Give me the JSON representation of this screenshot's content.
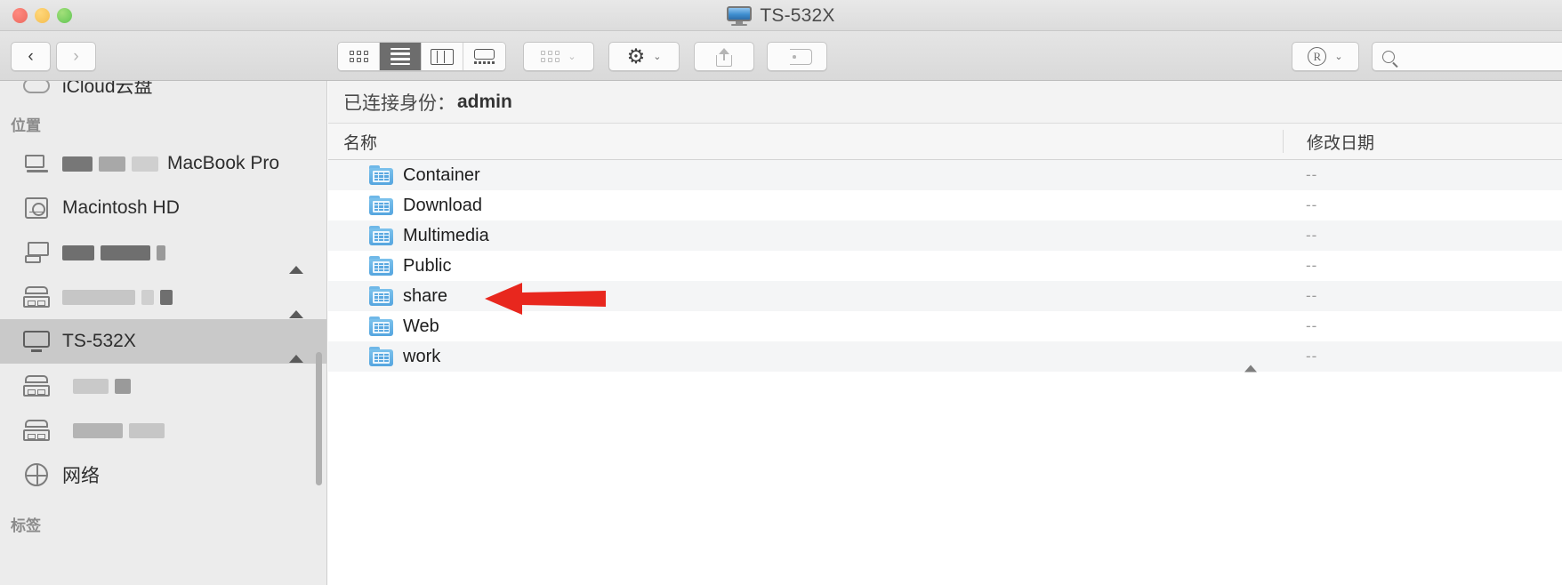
{
  "window": {
    "title": "TS-532X",
    "title_icon": "display-monitor-icon",
    "traffic_lights": [
      "close-button",
      "minimize-button",
      "zoom-button"
    ]
  },
  "toolbar": {
    "back_label": "‹",
    "forward_label": "›",
    "view_modes": [
      {
        "name": "icon-view",
        "label": "icon-grid-icon",
        "active": false
      },
      {
        "name": "list-view",
        "label": "list-lines-icon",
        "active": true
      },
      {
        "name": "column-view",
        "label": "columns-icon",
        "active": false
      },
      {
        "name": "gallery-view",
        "label": "gallery-icon",
        "active": false
      }
    ],
    "arrange_label": "arrange-grid-icon",
    "arrange_chevron": "⌄",
    "action_label": "⚙",
    "action_chevron": "⌄",
    "share_label": "share-upload-icon",
    "tag_label": "tag-icon",
    "rtm_label": "®",
    "rtm_chevron": "⌄",
    "search_icon": "search-magnifier-icon"
  },
  "sidebar": {
    "items": [
      {
        "name": "sidebar-item-icloud",
        "label": "iCloud云盘",
        "icon": "cloud-icon",
        "type": "item",
        "eject": false,
        "selected": false,
        "redacted": null
      },
      {
        "name": "sidebar-heading-locations",
        "label": "位置",
        "type": "heading"
      },
      {
        "name": "sidebar-item-macbook-pro",
        "label": "MacBook Pro",
        "icon": "laptop-screen-icon",
        "type": "item",
        "eject": false,
        "selected": false,
        "redacted": [
          34,
          30,
          30
        ]
      },
      {
        "name": "sidebar-item-macintosh-hd",
        "label": "Macintosh HD",
        "icon": "hard-disk-icon",
        "type": "item",
        "eject": false,
        "selected": false,
        "redacted": null
      },
      {
        "name": "sidebar-item-redacted-1",
        "label": "",
        "icon": "server-screen-icon",
        "type": "item",
        "eject": true,
        "selected": false,
        "redacted": [
          36,
          56,
          10
        ]
      },
      {
        "name": "sidebar-item-redacted-2",
        "label": "",
        "icon": "nas-icon",
        "type": "item",
        "eject": true,
        "selected": false,
        "redacted": [
          82,
          14,
          14
        ]
      },
      {
        "name": "sidebar-item-ts-532x",
        "label": "TS-532X",
        "icon": "display-monitor-icon",
        "type": "item",
        "eject": true,
        "selected": true,
        "redacted": null
      },
      {
        "name": "sidebar-item-redacted-3",
        "label": "",
        "icon": "nas-icon",
        "type": "item",
        "eject": false,
        "selected": false,
        "redacted": [
          40,
          18
        ]
      },
      {
        "name": "sidebar-item-redacted-4",
        "label": "",
        "icon": "nas-icon",
        "type": "item",
        "eject": false,
        "selected": false,
        "redacted": [
          56,
          40
        ]
      },
      {
        "name": "sidebar-item-network",
        "label": "网络",
        "icon": "globe-icon",
        "type": "item",
        "eject": false,
        "selected": false,
        "redacted": null
      },
      {
        "name": "sidebar-heading-tags",
        "label": "标签",
        "type": "heading"
      }
    ]
  },
  "main": {
    "connection_prefix": "已连接身份：",
    "connection_user": "admin",
    "columns": {
      "name": "名称",
      "date_modified": "修改日期"
    },
    "rows": [
      {
        "name": "Container",
        "date": "--",
        "icon": "shared-folder-icon",
        "eject": false
      },
      {
        "name": "Download",
        "date": "--",
        "icon": "shared-folder-icon",
        "eject": false
      },
      {
        "name": "Multimedia",
        "date": "--",
        "icon": "shared-folder-icon",
        "eject": false
      },
      {
        "name": "Public",
        "date": "--",
        "icon": "shared-folder-icon",
        "eject": false
      },
      {
        "name": "share",
        "date": "--",
        "icon": "shared-folder-icon",
        "eject": false
      },
      {
        "name": "Web",
        "date": "--",
        "icon": "shared-folder-icon",
        "eject": false
      },
      {
        "name": "work",
        "date": "--",
        "icon": "shared-folder-icon",
        "eject": true
      }
    ]
  },
  "annotation": {
    "arrow": {
      "name": "red-arrow-pointing-at-share",
      "color": "#e8271e",
      "points_to": "share"
    }
  },
  "colors": {
    "accent_folder": "#55a5df",
    "annotation_red": "#e8271e",
    "selection_gray": "#c9c9c9"
  }
}
